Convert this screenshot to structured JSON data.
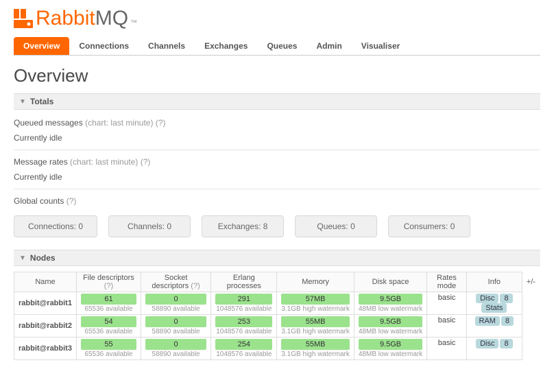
{
  "logo": {
    "rabbit": "Rabbit",
    "mq": "MQ",
    "tm": "™"
  },
  "tabs": [
    {
      "label": "Overview",
      "active": true
    },
    {
      "label": "Connections"
    },
    {
      "label": "Channels"
    },
    {
      "label": "Exchanges"
    },
    {
      "label": "Queues"
    },
    {
      "label": "Admin"
    },
    {
      "label": "Visualiser"
    }
  ],
  "page_title": "Overview",
  "sections": {
    "totals": "Totals",
    "nodes": "Nodes"
  },
  "totals": {
    "queued_label": "Queued messages",
    "queued_chart": "(chart: last minute)",
    "help": "(?)",
    "idle1": "Currently idle",
    "rates_label": "Message rates",
    "rates_chart": "(chart: last minute)",
    "idle2": "Currently idle",
    "global_label": "Global counts",
    "counts": [
      {
        "label": "Connections:",
        "value": "0"
      },
      {
        "label": "Channels:",
        "value": "0"
      },
      {
        "label": "Exchanges:",
        "value": "8"
      },
      {
        "label": "Queues:",
        "value": "0"
      },
      {
        "label": "Consumers:",
        "value": "0"
      }
    ]
  },
  "nodes_table": {
    "plusminus": "+/-",
    "headers": {
      "name": "Name",
      "fd": "File descriptors",
      "sd": "Socket descriptors",
      "erlang": "Erlang processes",
      "memory": "Memory",
      "disk": "Disk space",
      "rates": "Rates mode",
      "info": "Info"
    },
    "rows": [
      {
        "name": "rabbit@rabbit1",
        "fd": {
          "val": "61",
          "avail": "65536 available"
        },
        "sd": {
          "val": "0",
          "avail": "58890 available"
        },
        "erlang": {
          "val": "291",
          "avail": "1048576 available"
        },
        "memory": {
          "val": "57MB",
          "avail": "3.1GB high watermark"
        },
        "disk": {
          "val": "9.5GB",
          "avail": "48MB low watermark"
        },
        "rates": "basic",
        "info": [
          "Disc",
          "8",
          "Stats"
        ]
      },
      {
        "name": "rabbit@rabbit2",
        "fd": {
          "val": "54",
          "avail": "65536 available"
        },
        "sd": {
          "val": "0",
          "avail": "58890 available"
        },
        "erlang": {
          "val": "253",
          "avail": "1048576 available"
        },
        "memory": {
          "val": "55MB",
          "avail": "3.1GB high watermark"
        },
        "disk": {
          "val": "9.5GB",
          "avail": "48MB low watermark"
        },
        "rates": "basic",
        "info": [
          "RAM",
          "8"
        ]
      },
      {
        "name": "rabbit@rabbit3",
        "fd": {
          "val": "55",
          "avail": "65536 available"
        },
        "sd": {
          "val": "0",
          "avail": "58890 available"
        },
        "erlang": {
          "val": "254",
          "avail": "1048576 available"
        },
        "memory": {
          "val": "55MB",
          "avail": "3.1GB high watermark"
        },
        "disk": {
          "val": "9.5GB",
          "avail": "48MB low watermark"
        },
        "rates": "basic",
        "info": [
          "Disc",
          "8"
        ]
      }
    ]
  }
}
